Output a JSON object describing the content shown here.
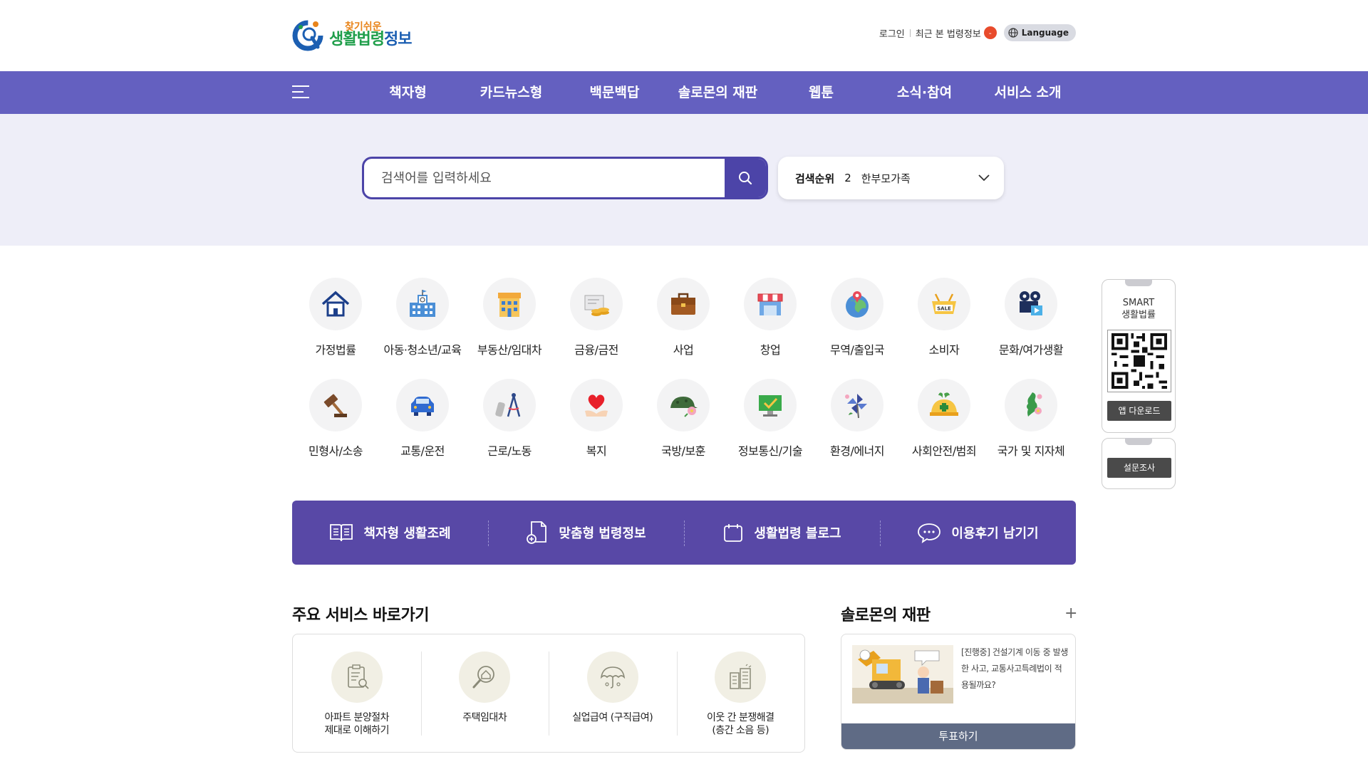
{
  "header": {
    "logo_small": "찾기쉬운",
    "logo_big_green": "생활법령",
    "logo_big_blue": "정보",
    "login": "로그인",
    "recent": "최근 본 법령정보",
    "recent_badge": "-",
    "language": "Language"
  },
  "nav": {
    "items": [
      "책자형",
      "카드뉴스형",
      "백문백답",
      "솔로몬의 재판",
      "웹툰",
      "소식·참여",
      "서비스 소개"
    ]
  },
  "search": {
    "placeholder": "검색어를 입력하세요",
    "rank_label": "검색순위",
    "rank_number": "2",
    "rank_term": "한부모가족"
  },
  "categories": [
    {
      "label": "가정법률",
      "icon": "house-icon"
    },
    {
      "label": "아동·청소년/교육",
      "icon": "school-icon"
    },
    {
      "label": "부동산/임대차",
      "icon": "building-icon"
    },
    {
      "label": "금융/금전",
      "icon": "money-icon"
    },
    {
      "label": "사업",
      "icon": "briefcase-icon"
    },
    {
      "label": "창업",
      "icon": "store-icon"
    },
    {
      "label": "무역/출입국",
      "icon": "globe-icon"
    },
    {
      "label": "소비자",
      "icon": "sale-basket-icon"
    },
    {
      "label": "문화/여가생활",
      "icon": "camera-icon"
    },
    {
      "label": "민형사/소송",
      "icon": "gavel-icon"
    },
    {
      "label": "교통/운전",
      "icon": "car-icon"
    },
    {
      "label": "근로/노동",
      "icon": "compass-icon"
    },
    {
      "label": "복지",
      "icon": "heart-hand-icon"
    },
    {
      "label": "국방/보훈",
      "icon": "helmet-icon"
    },
    {
      "label": "정보통신/기술",
      "icon": "monitor-icon"
    },
    {
      "label": "환경/에너지",
      "icon": "pinwheel-icon"
    },
    {
      "label": "사회안전/범죄",
      "icon": "safety-icon"
    },
    {
      "label": "국가 및 지자체",
      "icon": "korea-map-icon"
    }
  ],
  "side": {
    "smart_line1": "SMART",
    "smart_line2": "생활법률",
    "app_download": "앱 다운로드",
    "survey": "설문조사"
  },
  "quick": [
    {
      "label": "책자형 생활조례",
      "icon": "book-icon"
    },
    {
      "label": "맞춤형 법령정보",
      "icon": "document-search-icon"
    },
    {
      "label": "생활법령 블로그",
      "icon": "calendar-icon"
    },
    {
      "label": "이용후기 남기기",
      "icon": "chat-icon"
    }
  ],
  "services": {
    "title": "주요 서비스 바로가기",
    "items": [
      {
        "line1": "아파트 분양절차",
        "line2": "제대로 이해하기",
        "icon": "clipboard-search-icon"
      },
      {
        "line1": "주택임대차",
        "line2": "",
        "icon": "house-magnifier-icon"
      },
      {
        "line1": "실업급여 (구직급여)",
        "line2": "",
        "icon": "umbrella-icon"
      },
      {
        "line1": "이웃 간 분쟁해결",
        "line2": "(층간 소음 등)",
        "icon": "apartment-icon"
      }
    ]
  },
  "solomon": {
    "title": "솔로몬의 재판",
    "more": "+",
    "text": "[진행중] 건설기계 이동 중 발생한 사고, 교통사고특례법이 적용될까요?",
    "vote": "투표하기"
  },
  "colors": {
    "nav": "#6460c0",
    "search_border": "#4c44a8",
    "quick_bar": "#5848a6",
    "vote": "#5f6b85"
  }
}
